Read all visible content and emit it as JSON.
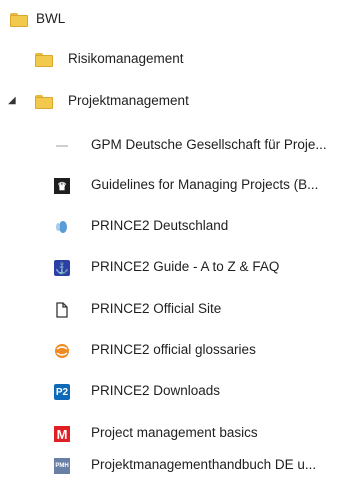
{
  "tree": {
    "root": {
      "label": "BWL"
    },
    "children": [
      {
        "label": "Risikomanagement"
      },
      {
        "label": "Projektmanagement",
        "expanded": true
      }
    ],
    "bookmarks": [
      {
        "label": "GPM Deutsche Gesellschaft für Proje...",
        "icon": "dash-icon"
      },
      {
        "label": "Guidelines for Managing Projects (B...",
        "icon": "crown-icon"
      },
      {
        "label": "PRINCE2 Deutschland",
        "icon": "swirl-icon"
      },
      {
        "label": "PRINCE2 Guide - A to Z & FAQ",
        "icon": "anchor-icon"
      },
      {
        "label": "PRINCE2 Official Site",
        "icon": "page-icon"
      },
      {
        "label": "PRINCE2 official glossaries",
        "icon": "orange-sphere-icon"
      },
      {
        "label": "PRINCE2 Downloads",
        "icon": "p2-icon",
        "icon_text": "P2"
      },
      {
        "label": "Project management basics",
        "icon": "m-icon",
        "icon_text": "M"
      },
      {
        "label": "Projektmanagementhandbuch DE u...",
        "icon": "pmh-icon",
        "icon_text": "PMH"
      }
    ]
  },
  "colors": {
    "folder": "#f2c94c",
    "p2": "#0e6ab8",
    "m": "#e01e24"
  }
}
